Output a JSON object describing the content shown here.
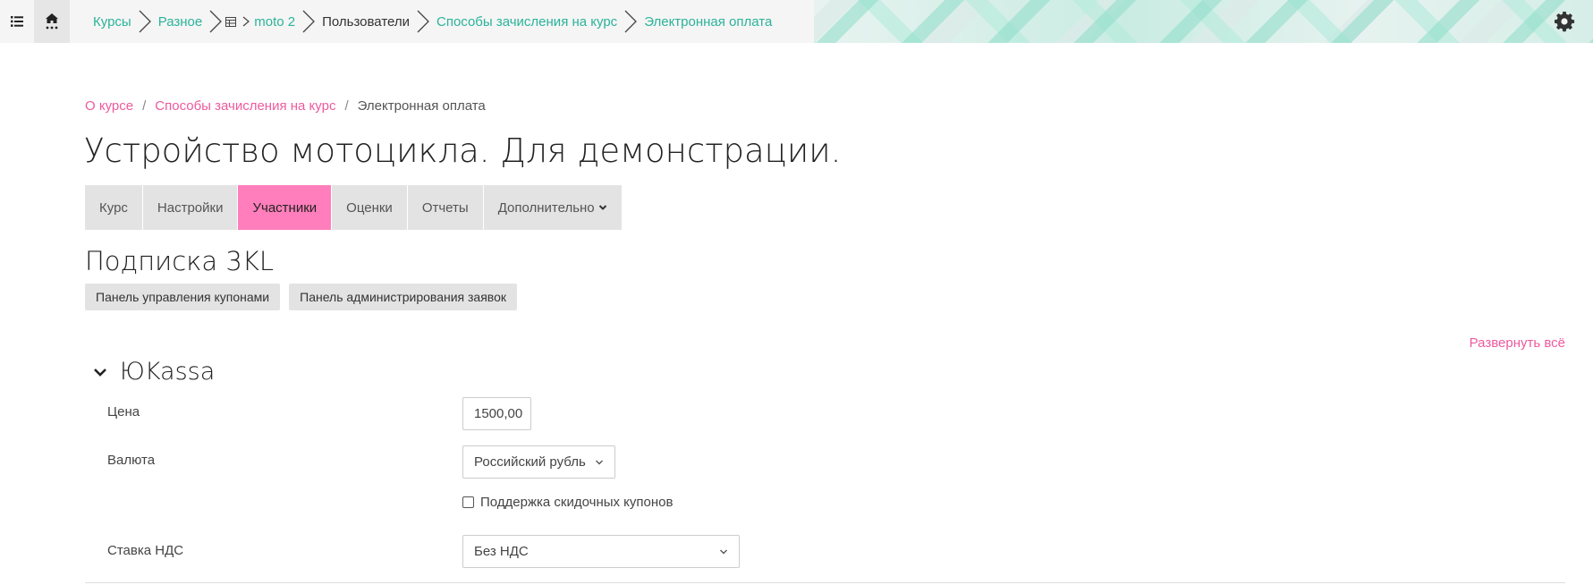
{
  "navbar": {
    "breadcrumbs": [
      {
        "label": "Курсы",
        "current": false
      },
      {
        "label": "Разное",
        "current": false
      },
      {
        "label": "moto 2",
        "current": false,
        "icon": "table-icon"
      },
      {
        "label": "Пользователи",
        "current": true
      },
      {
        "label": "Способы зачисления на курс",
        "current": false
      },
      {
        "label": "Электронная оплата",
        "current": false
      }
    ]
  },
  "page_breadcrumb": {
    "items": [
      "О курсе",
      "Способы зачисления на курс"
    ],
    "current": "Электронная оплата",
    "separator": "/"
  },
  "page_title": "Устройство мотоцикла. Для демонстрации.",
  "tabs": [
    {
      "label": "Курс",
      "active": false
    },
    {
      "label": "Настройки",
      "active": false
    },
    {
      "label": "Участники",
      "active": true
    },
    {
      "label": "Оценки",
      "active": false
    },
    {
      "label": "Отчеты",
      "active": false
    },
    {
      "label": "Дополнительно",
      "active": false,
      "dropdown": true
    }
  ],
  "section_title": "Подписка 3KL",
  "buttons": {
    "coupons": "Панель управления купонами",
    "requests": "Панель администрирования заявок"
  },
  "expand_all": "Развернуть всё",
  "fieldset": {
    "legend": "ЮKassa",
    "price_label": "Цена",
    "price_value": "1500,00",
    "currency_label": "Валюта",
    "currency_value": "Российский рубль",
    "coupon_label": "Поддержка скидочных купонов",
    "coupon_checked": false,
    "vat_label": "Ставка НДС",
    "vat_value": "Без НДС"
  },
  "colors": {
    "accent_pink": "#ee5a9e",
    "active_tab": "#ff7ebb",
    "nav_link": "#2bb39a"
  }
}
